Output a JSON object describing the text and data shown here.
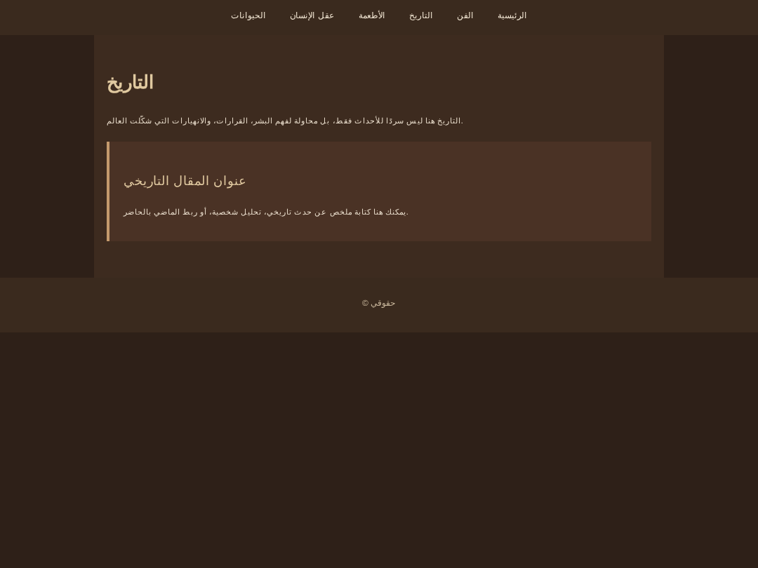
{
  "nav": [
    {
      "label": "الرئيسية"
    },
    {
      "label": "الفن"
    },
    {
      "label": "التاريخ"
    },
    {
      "label": "الأطعمة"
    },
    {
      "label": "عقل الإنسان"
    },
    {
      "label": "الحيوانات"
    }
  ],
  "main": {
    "title": "التاريخ",
    "intro": "التاريخ هنا ليس سردًا للأحداث فقط، بل محاولة لفهم البشر، القرارات، والانهيارات التي شكّلت العالم.",
    "article": {
      "title": "عنوان المقال التاريخي",
      "body": "يمكنك هنا كتابة ملخص عن حدث تاريخي، تحليل شخصية، أو ربط الماضي بالحاضر."
    }
  },
  "footer": "© حقوقي"
}
